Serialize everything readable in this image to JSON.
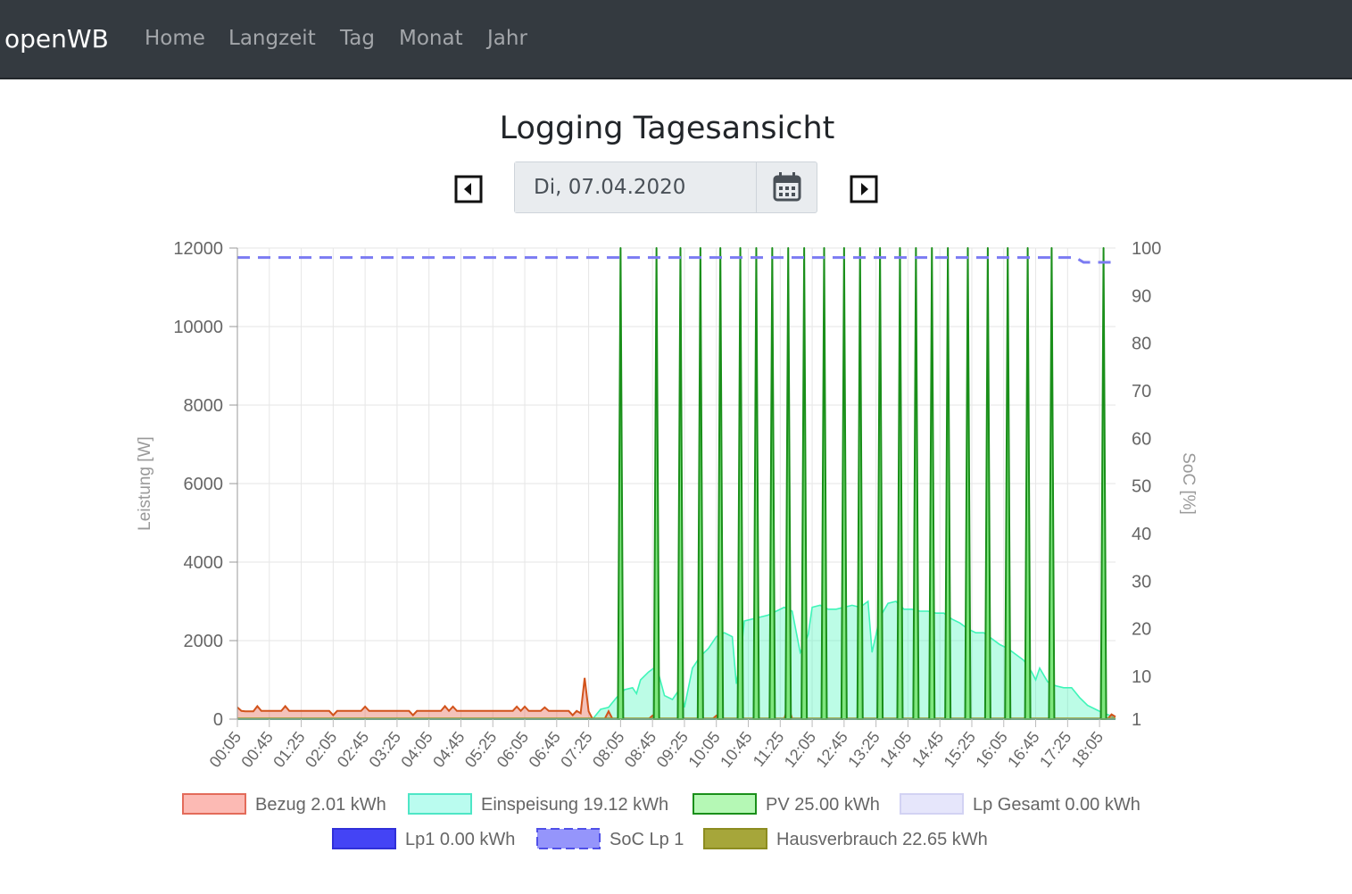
{
  "navbar": {
    "brand": "openWB",
    "items": [
      "Home",
      "Langzeit",
      "Tag",
      "Monat",
      "Jahr"
    ]
  },
  "page": {
    "title": "Logging Tagesansicht",
    "date_value": "Di, 07.04.2020"
  },
  "icons": {
    "prev": "caret-left-square-icon",
    "next": "caret-right-square-icon",
    "calendar": "calendar-icon"
  },
  "colors": {
    "navbar_bg": "#343a40",
    "bezug": "#e0503a",
    "einspeisung": "#3ff5b8",
    "pv": "#1a8f1a",
    "soc": "#7b7bf2",
    "lp1": "#3c3cf5",
    "hausverbrauch": "#9b9b2a",
    "lp_gesamt": "#e3e3fb"
  },
  "chart_data": {
    "type": "line",
    "title": "",
    "ylabel": "Leistung [W]",
    "y2label": "SoC [%]",
    "ylim": [
      0,
      12000
    ],
    "y2lim": [
      1,
      100
    ],
    "y_ticks": [
      0,
      2000,
      4000,
      6000,
      8000,
      10000,
      12000
    ],
    "y2_ticks": [
      1,
      10,
      20,
      30,
      40,
      50,
      60,
      70,
      80,
      90,
      100
    ],
    "x_ticks": [
      "00:05",
      "00:45",
      "01:25",
      "02:05",
      "02:45",
      "03:25",
      "04:05",
      "04:45",
      "05:25",
      "06:05",
      "06:45",
      "07:25",
      "08:05",
      "08:45",
      "09:25",
      "10:05",
      "10:45",
      "11:25",
      "12:05",
      "12:45",
      "13:25",
      "14:05",
      "14:45",
      "15:25",
      "16:05",
      "16:45",
      "17:25",
      "18:05"
    ],
    "x_range": [
      "00:05",
      "18:25"
    ],
    "grid": true,
    "legend_position": "bottom",
    "legend": [
      "Bezug 2.01 kWh",
      "Einspeisung 19.12 kWh",
      "PV 25.00 kWh",
      "Lp Gesamt 0.00 kWh",
      "Lp1 0.00 kWh",
      "SoC Lp 1",
      "Hausverbrauch 22.65 kWh"
    ],
    "series": [
      {
        "name": "Bezug 2.01 kWh",
        "unit": "W",
        "axis": "left",
        "points": [
          [
            "00:05",
            300
          ],
          [
            "00:10",
            210
          ],
          [
            "00:15",
            200
          ],
          [
            "00:25",
            200
          ],
          [
            "00:30",
            330
          ],
          [
            "00:35",
            210
          ],
          [
            "01:00",
            210
          ],
          [
            "01:05",
            330
          ],
          [
            "01:10",
            210
          ],
          [
            "02:00",
            210
          ],
          [
            "02:05",
            100
          ],
          [
            "02:10",
            210
          ],
          [
            "02:40",
            210
          ],
          [
            "02:45",
            320
          ],
          [
            "02:50",
            210
          ],
          [
            "03:40",
            210
          ],
          [
            "03:45",
            100
          ],
          [
            "03:50",
            210
          ],
          [
            "04:20",
            210
          ],
          [
            "04:25",
            330
          ],
          [
            "04:30",
            210
          ],
          [
            "04:35",
            320
          ],
          [
            "04:40",
            210
          ],
          [
            "05:50",
            210
          ],
          [
            "05:55",
            320
          ],
          [
            "06:00",
            210
          ],
          [
            "06:05",
            320
          ],
          [
            "06:10",
            210
          ],
          [
            "06:25",
            210
          ],
          [
            "06:30",
            300
          ],
          [
            "06:35",
            210
          ],
          [
            "07:00",
            210
          ],
          [
            "07:05",
            100
          ],
          [
            "07:10",
            210
          ],
          [
            "07:15",
            150
          ],
          [
            "07:20",
            1050
          ],
          [
            "07:25",
            200
          ],
          [
            "07:30",
            0
          ],
          [
            "07:45",
            0
          ],
          [
            "07:50",
            200
          ],
          [
            "07:55",
            0
          ],
          [
            "08:40",
            0
          ],
          [
            "08:45",
            90
          ],
          [
            "08:50",
            0
          ],
          [
            "10:00",
            0
          ],
          [
            "10:05",
            90
          ],
          [
            "10:10",
            0
          ],
          [
            "11:30",
            0
          ],
          [
            "11:35",
            350
          ],
          [
            "11:40",
            0
          ],
          [
            "18:15",
            0
          ],
          [
            "18:20",
            120
          ],
          [
            "18:25",
            60
          ]
        ]
      },
      {
        "name": "Einspeisung 19.12 kWh",
        "unit": "W",
        "axis": "left",
        "points": [
          [
            "07:30",
            0
          ],
          [
            "07:40",
            250
          ],
          [
            "07:50",
            300
          ],
          [
            "08:00",
            550
          ],
          [
            "08:10",
            750
          ],
          [
            "08:20",
            800
          ],
          [
            "08:25",
            650
          ],
          [
            "08:30",
            1000
          ],
          [
            "08:40",
            1200
          ],
          [
            "08:50",
            1350
          ],
          [
            "09:00",
            600
          ],
          [
            "09:10",
            500
          ],
          [
            "09:15",
            650
          ],
          [
            "09:20",
            800
          ],
          [
            "09:25",
            300
          ],
          [
            "09:35",
            1300
          ],
          [
            "09:45",
            1600
          ],
          [
            "09:55",
            1800
          ],
          [
            "10:05",
            2100
          ],
          [
            "10:15",
            2200
          ],
          [
            "10:25",
            2100
          ],
          [
            "10:30",
            900
          ],
          [
            "10:35",
            1500
          ],
          [
            "10:40",
            2500
          ],
          [
            "10:50",
            2550
          ],
          [
            "11:00",
            2600
          ],
          [
            "11:10",
            2650
          ],
          [
            "11:20",
            2750
          ],
          [
            "11:30",
            2850
          ],
          [
            "11:40",
            2750
          ],
          [
            "11:50",
            1700
          ],
          [
            "11:55",
            1900
          ],
          [
            "12:00",
            2150
          ],
          [
            "12:05",
            2850
          ],
          [
            "12:15",
            2900
          ],
          [
            "12:25",
            2800
          ],
          [
            "12:35",
            2800
          ],
          [
            "12:45",
            2850
          ],
          [
            "12:55",
            2900
          ],
          [
            "13:05",
            2850
          ],
          [
            "13:15",
            3000
          ],
          [
            "13:20",
            1700
          ],
          [
            "13:30",
            2600
          ],
          [
            "13:40",
            2950
          ],
          [
            "13:50",
            3000
          ],
          [
            "14:00",
            2800
          ],
          [
            "14:10",
            2800
          ],
          [
            "14:20",
            2750
          ],
          [
            "14:30",
            2750
          ],
          [
            "14:40",
            2700
          ],
          [
            "14:50",
            2700
          ],
          [
            "15:00",
            2550
          ],
          [
            "15:10",
            2450
          ],
          [
            "15:20",
            2300
          ],
          [
            "15:30",
            2200
          ],
          [
            "15:40",
            2200
          ],
          [
            "15:50",
            2050
          ],
          [
            "16:00",
            1900
          ],
          [
            "16:10",
            1800
          ],
          [
            "16:20",
            1650
          ],
          [
            "16:30",
            1500
          ],
          [
            "16:40",
            1200
          ],
          [
            "16:45",
            1000
          ],
          [
            "16:50",
            1300
          ],
          [
            "17:00",
            950
          ],
          [
            "17:10",
            850
          ],
          [
            "17:20",
            800
          ],
          [
            "17:30",
            800
          ],
          [
            "17:40",
            550
          ],
          [
            "17:50",
            350
          ],
          [
            "18:00",
            250
          ],
          [
            "18:10",
            150
          ],
          [
            "18:20",
            80
          ],
          [
            "18:25",
            0
          ]
        ]
      },
      {
        "name": "PV 25.00 kWh",
        "unit": "W",
        "axis": "left",
        "spikes_to": 12000,
        "spike_times": [
          "08:05",
          "08:50",
          "09:20",
          "09:45",
          "10:10",
          "10:35",
          "10:55",
          "11:15",
          "11:35",
          "11:55",
          "12:20",
          "12:45",
          "13:05",
          "13:30",
          "13:55",
          "14:15",
          "14:35",
          "14:55",
          "15:20",
          "15:45",
          "16:10",
          "16:35",
          "17:05",
          "18:10"
        ]
      },
      {
        "name": "Lp Gesamt 0.00 kWh",
        "unit": "W",
        "axis": "left",
        "constant": 0
      },
      {
        "name": "Lp1 0.00 kWh",
        "unit": "W",
        "axis": "left",
        "constant": 0
      },
      {
        "name": "SoC Lp 1",
        "unit": "%",
        "axis": "right",
        "points": [
          [
            "00:05",
            98
          ],
          [
            "17:35",
            98
          ],
          [
            "17:45",
            97
          ],
          [
            "18:25",
            97
          ]
        ]
      },
      {
        "name": "Hausverbrauch 22.65 kWh",
        "unit": "W",
        "axis": "left",
        "constant": 0
      }
    ]
  }
}
